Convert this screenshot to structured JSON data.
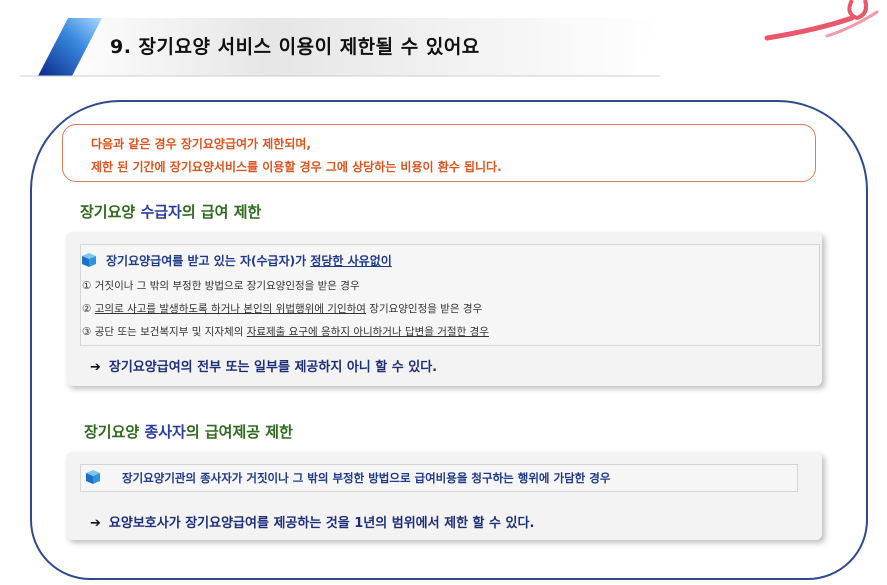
{
  "header": {
    "title": "9. 장기요양 서비스 이용이 제한될 수 있어요"
  },
  "notice": {
    "line1": "다음과 같은 경우 장기요양급여가 제한되며,",
    "line2": "제한 된 기간에 장기요양서비스를 이용할 경우  그에 상당하는 비용이 환수 됩니다."
  },
  "section1": {
    "heading_prefix": "장기요양 ",
    "heading_highlight": "수급자",
    "heading_suffix": "의 급여 제한",
    "condition_prefix": "장기요양급여를 받고 있는 자(수급자)가 ",
    "condition_underlined": "정당한 사유없이",
    "items": [
      {
        "number": "①",
        "text": "거짓이나 그 밖의 부정한 방법으로 장기요양인정을 받은 경우"
      },
      {
        "number": "②",
        "text_underlined": "고의로 사고를 발생하도록 하거나 본인의 위법행위에 기인하여",
        "text_rest": " 장기요양인정을 받은 경우"
      },
      {
        "number": "③",
        "text_prefix": "공단 또는 보건복지부 및 지자체의 ",
        "text_underlined": "자료제출 요구에 응하지 아니하거나 답변을 거절한 경우",
        "text_rest": ""
      }
    ],
    "result": "장기요양급여의 전부 또는 일부를 제공하지 아니 할 수 있다."
  },
  "section2": {
    "heading_prefix": "장기요양 ",
    "heading_highlight": "종사자",
    "heading_suffix": "의 급여제공 제한",
    "condition": "장기요양기관의 종사자가 거짓이나 그 밖의 부정한 방법으로 급여비용을 청구하는 행위에 가담한 경우",
    "result": "요양보호사가 장기요양급여를 제공하는 것을 1년의 범위에서 제한 할 수 있다."
  },
  "colors": {
    "frame": "#2d4a8e",
    "notice_border": "#e07a5a",
    "notice_text": "#d9541f",
    "heading_green": "#2f6b1e",
    "heading_blue": "#2a3c9c",
    "body_blue": "#1e3a8a"
  },
  "icons": [
    "blue-cube-icon",
    "right-arrow-icon",
    "red-ribbon-icon"
  ]
}
